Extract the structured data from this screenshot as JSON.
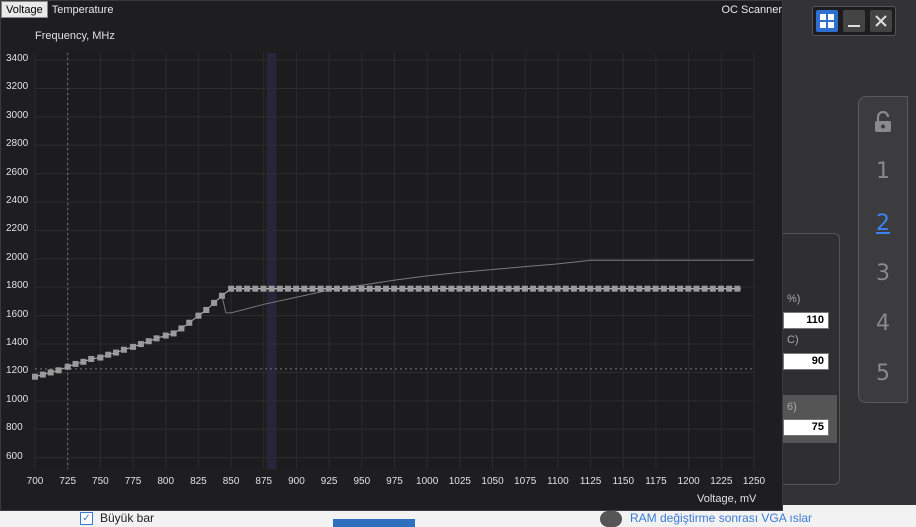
{
  "tabs": [
    {
      "label": "Voltage",
      "active": true
    },
    {
      "label": "Temperature",
      "active": false
    }
  ],
  "oc_scanner_label": "OC Scanner",
  "window_controls": {
    "icons": [
      "windows-logo-icon",
      "minimize-icon",
      "close-icon"
    ]
  },
  "profiles": {
    "lock_icon": "unlock-icon",
    "items": [
      {
        "label": "1",
        "active": false
      },
      {
        "label": "2",
        "active": true
      },
      {
        "label": "3",
        "active": false
      },
      {
        "label": "4",
        "active": false
      },
      {
        "label": "5",
        "active": false
      }
    ]
  },
  "side_fields": [
    {
      "label": "%)",
      "value": "110"
    },
    {
      "label": "C)",
      "value": "90"
    },
    {
      "label": "6)",
      "value": "75"
    }
  ],
  "background": {
    "checkbox_label": "Büyük bar",
    "link_text": "RAM değiştirme sonrası VGA ıslar"
  },
  "colors": {
    "editor_bg": "#1e1e20",
    "grid": "#2c2c30",
    "curve_points": "#9a9a9a",
    "active_profile": "#3b82f6"
  },
  "chart_data": {
    "type": "line",
    "ylabel": "Frequency, MHz",
    "xlabel": "Voltage, mV",
    "xlim": [
      700,
      1250
    ],
    "ylim": [
      520,
      3450
    ],
    "xticks": [
      700,
      725,
      750,
      775,
      800,
      825,
      850,
      875,
      900,
      925,
      950,
      975,
      1000,
      1025,
      1050,
      1075,
      1100,
      1125,
      1150,
      1175,
      1200,
      1225,
      1250
    ],
    "yticks": [
      600,
      800,
      1000,
      1200,
      1400,
      1600,
      1800,
      2000,
      2200,
      2400,
      2600,
      2800,
      3000,
      3200,
      3400
    ],
    "cursor_voltage": 725,
    "reference_frequency": 1225,
    "highlight_voltage": 881,
    "series": [
      {
        "x": [
          700,
          706,
          712,
          718,
          725,
          731,
          737,
          743,
          750,
          756,
          762,
          768,
          775,
          781,
          787,
          793,
          800,
          806,
          812,
          818,
          825,
          831,
          837,
          843,
          850
        ],
        "y": [
          1170,
          1185,
          1200,
          1215,
          1240,
          1260,
          1275,
          1295,
          1305,
          1325,
          1340,
          1360,
          1380,
          1400,
          1420,
          1440,
          1460,
          1475,
          1510,
          1550,
          1600,
          1640,
          1690,
          1740,
          1790
        ]
      },
      {
        "x": [
          850,
          1240
        ],
        "y": [
          1790,
          1790
        ]
      },
      {
        "x": [
          850,
          875,
          900,
          925,
          950,
          975,
          1000,
          1025,
          1050,
          1075,
          1100,
          1115,
          1125,
          1150,
          1175,
          1200,
          1225,
          1250
        ],
        "y": [
          1620,
          1680,
          1730,
          1780,
          1815,
          1850,
          1880,
          1905,
          1925,
          1945,
          1965,
          1980,
          1990,
          1990,
          1990,
          1990,
          1990,
          1990
        ]
      }
    ]
  }
}
